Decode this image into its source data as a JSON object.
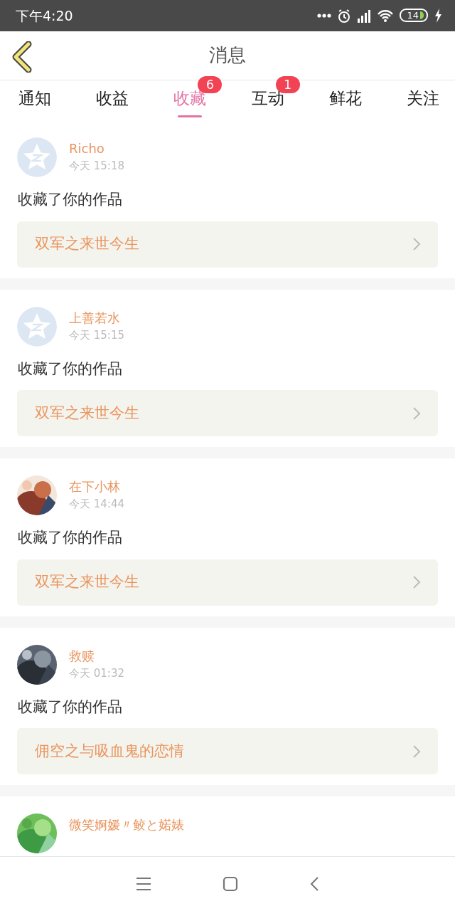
{
  "status_bar": {
    "time": "下午4:20",
    "battery": "14"
  },
  "header": {
    "title": "消息"
  },
  "tabs": [
    {
      "label": "通知",
      "selected": false
    },
    {
      "label": "收益",
      "selected": false
    },
    {
      "label": "收藏",
      "selected": true,
      "badge": "6"
    },
    {
      "label": "互动",
      "selected": false,
      "badge": "1"
    },
    {
      "label": "鲜花",
      "selected": false
    },
    {
      "label": "关注",
      "selected": false
    }
  ],
  "messages": [
    {
      "kind": "default",
      "name": "Richo",
      "time": "今天 15:18",
      "action": "收藏了你的作品",
      "work": "双军之来世今生"
    },
    {
      "kind": "default",
      "name": "上善若水",
      "time": "今天 15:15",
      "action": "收藏了你的作品",
      "work": "双军之来世今生"
    },
    {
      "kind": "picture",
      "name": "在下小林",
      "time": "今天 14:44",
      "action": "收藏了你的作品",
      "work": "双军之来世今生"
    },
    {
      "kind": "picture",
      "name": "救赎",
      "time": "今天 01:32",
      "action": "收藏了你的作品",
      "work": "佣空之与吸血鬼的恋情"
    },
    {
      "kind": "picture",
      "name": "微笑婀嫒〃鲛と婼婊"
    }
  ]
}
